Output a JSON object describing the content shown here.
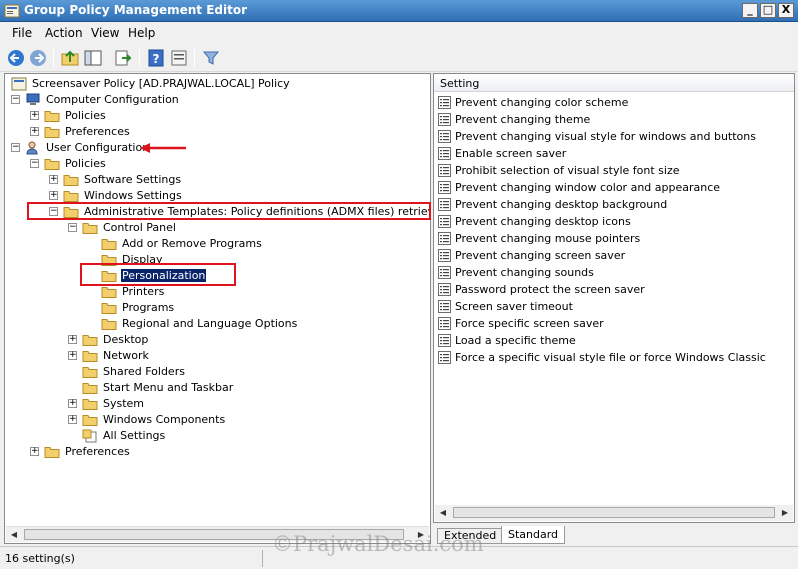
{
  "window": {
    "title": "Group Policy Management Editor"
  },
  "window_controls": {
    "minimize": "_",
    "restore": "□",
    "close": "X"
  },
  "menu": [
    "File",
    "Action",
    "View",
    "Help"
  ],
  "toolbar_icons": [
    "back-icon",
    "forward-icon",
    "up-folder-icon",
    "show-hide-tree-icon",
    "export-list-icon",
    "help-icon",
    "properties-icon",
    "filter-icon"
  ],
  "tree": {
    "root": "Screensaver Policy [AD.PRAJWAL.LOCAL] Policy",
    "computer_configuration": "Computer Configuration",
    "computer_policies": "Policies",
    "computer_preferences": "Preferences",
    "user_configuration": "User Configuration",
    "user_policies": "Policies",
    "software_settings": "Software Settings",
    "windows_settings": "Windows Settings",
    "administrative_templates": "Administrative Templates: Policy definitions (ADMX files) retrieved from",
    "control_panel": "Control Panel",
    "add_remove_programs": "Add or Remove Programs",
    "display": "Display",
    "personalization": "Personalization",
    "printers": "Printers",
    "programs": "Programs",
    "regional_language": "Regional and Language Options",
    "desktop": "Desktop",
    "network": "Network",
    "shared_folders": "Shared Folders",
    "start_menu": "Start Menu and Taskbar",
    "system": "System",
    "windows_components": "Windows Components",
    "all_settings": "All Settings",
    "user_preferences": "Preferences"
  },
  "settings_pane": {
    "column_header": "Setting",
    "items": [
      "Prevent changing color scheme",
      "Prevent changing theme",
      "Prevent changing visual style for windows and buttons",
      "Enable screen saver",
      "Prohibit selection of visual style font size",
      "Prevent changing window color and appearance",
      "Prevent changing desktop background",
      "Prevent changing desktop icons",
      "Prevent changing mouse pointers",
      "Prevent changing screen saver",
      "Prevent changing sounds",
      "Password protect the screen saver",
      "Screen saver timeout",
      "Force specific screen saver",
      "Load a specific theme",
      "Force a specific visual style file or force Windows Classic"
    ]
  },
  "tabs": {
    "extended": "Extended",
    "standard": "Standard"
  },
  "status": {
    "text": "16 setting(s)"
  },
  "watermark": "©PrajwalDesai.com",
  "colors": {
    "highlight": "#e0121b",
    "selection": "#0a246a",
    "titlebar": "#2f6fb5"
  }
}
